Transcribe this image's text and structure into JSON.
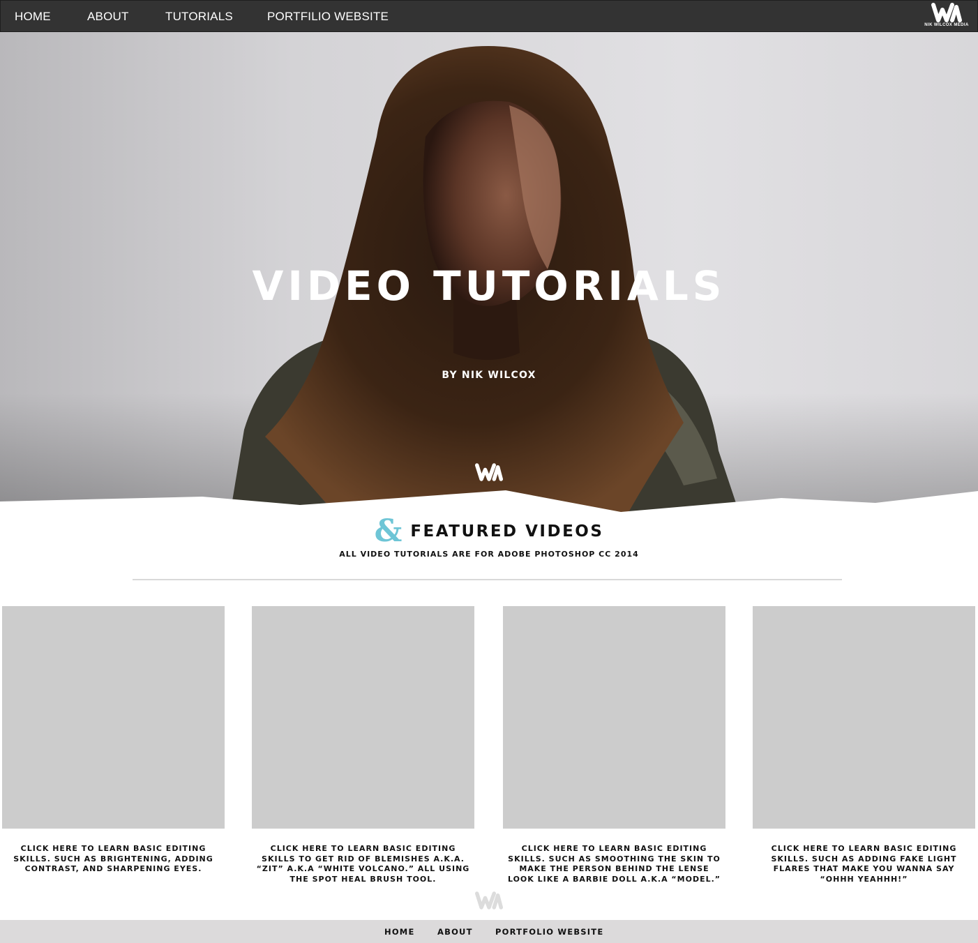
{
  "nav": {
    "items": [
      {
        "label": "HOME"
      },
      {
        "label": "ABOUT"
      },
      {
        "label": "TUTORIALS"
      },
      {
        "label": "PORTFILIO WEBSITE"
      }
    ],
    "brand_label": "NIK WILCOX MEDIA",
    "logo_icon": "wm-logo-icon"
  },
  "hero": {
    "title": "VIDEO TUTORIALS",
    "subtitle": "BY NIK WILCOX"
  },
  "featured": {
    "ampersand": "&",
    "title": "FEATURED VIDEOS",
    "subtitle": "ALL VIDEO TUTORIALS ARE FOR ADOBE PHOTOSHOP CC 2014",
    "accent_color": "#6ec5d6"
  },
  "videos": [
    {
      "caption": "CLICK HERE TO LEARN BASIC EDITING SKILLS. SUCH AS BRIGHTENING, ADDING CONTRAST, AND SHARPENING EYES."
    },
    {
      "caption": "CLICK HERE TO LEARN BASIC EDITING SKILLS TO GET RID OF BLEMISHES A.K.A. “ZIT” A.K.A “WHITE VOLCANO.” ALL USING THE SPOT HEAL BRUSH TOOL."
    },
    {
      "caption": "CLICK HERE TO LEARN BASIC EDITING SKILLS. SUCH AS SMOOTHING THE SKIN TO MAKE THE PERSON BEHIND THE LENSE LOOK LIKE A BARBIE DOLL A.K.A “MODEL.”"
    },
    {
      "caption": "CLICK HERE TO LEARN BASIC EDITING SKILLS. SUCH AS ADDING FAKE LIGHT FLARES THAT MAKE YOU WANNA SAY “OHHH YEAHHH!”"
    }
  ],
  "footer": {
    "items": [
      {
        "label": "HOME"
      },
      {
        "label": "ABOUT"
      },
      {
        "label": "PORTFOLIO WEBSITE"
      }
    ],
    "background": "#dcdadb"
  },
  "colors": {
    "nav_bg": "#333333",
    "thumb_placeholder": "#cccccc"
  }
}
